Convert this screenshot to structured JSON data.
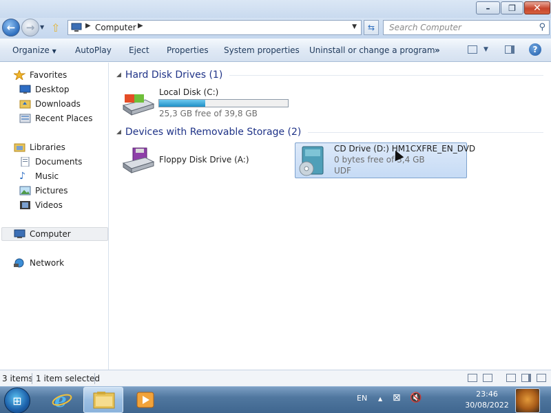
{
  "window": {
    "minimize_label": "–",
    "maximize_label": "❐",
    "close_label": "✕"
  },
  "navigation": {
    "back_icon": "←",
    "forward_icon": "→",
    "address": {
      "breadcrumb": "Computer"
    },
    "search": {
      "placeholder": "Search Computer"
    }
  },
  "toolbar": {
    "organize_label": "Organize",
    "autoplay_label": "AutoPlay",
    "eject_label": "Eject",
    "properties_label": "Properties",
    "system_properties_label": "System properties",
    "uninstall_label": "Uninstall or change a program",
    "overflow_label": "»",
    "help_label": "?"
  },
  "sidebar": {
    "favorites": "Favorites",
    "desktop": "Desktop",
    "downloads": "Downloads",
    "recent_places": "Recent Places",
    "libraries": "Libraries",
    "documents": "Documents",
    "music": "Music",
    "pictures": "Pictures",
    "videos": "Videos",
    "computer": "Computer",
    "network": "Network"
  },
  "content": {
    "groups": [
      {
        "header": "Hard Disk Drives (1)",
        "drives": [
          {
            "name": "Local Disk (C:)",
            "free": "25,3 GB free of 39,8 GB",
            "used_fraction": 0.36
          }
        ]
      },
      {
        "header": "Devices with Removable Storage (2)",
        "drives": [
          {
            "name": "Floppy Disk Drive (A:)"
          },
          {
            "name": "CD Drive (D:) HM1CXFRE_EN_DVD",
            "free": "0 bytes free of 3,4 GB",
            "filesystem": "UDF",
            "selected": true
          }
        ]
      }
    ]
  },
  "status": {
    "item_count": "3 items",
    "selection": "1 item selected"
  },
  "taskbar": {
    "language": "EN",
    "tray_arrow": "▲",
    "time": "23:46",
    "date": "30/08/2022"
  },
  "colors": {
    "group_header": "#1e3287",
    "progress_fill": "#1e8fc6",
    "selection_bg": "#cfe0f6"
  },
  "icons": {
    "favorites": "star-icon",
    "desktop": "desktop-icon",
    "downloads": "folder-download-icon",
    "recent_places": "recent-places-icon",
    "libraries": "libraries-icon",
    "documents": "documents-icon",
    "music": "music-icon",
    "pictures": "pictures-icon",
    "videos": "videos-icon",
    "computer": "computer-icon",
    "network": "network-icon"
  }
}
